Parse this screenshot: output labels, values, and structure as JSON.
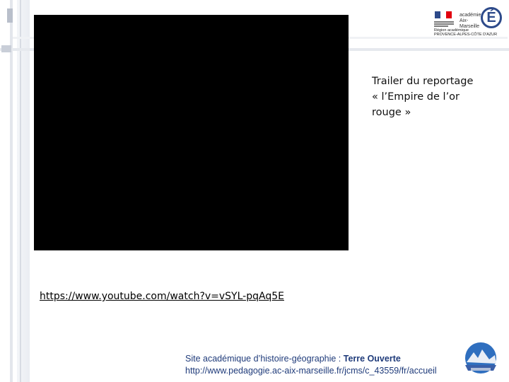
{
  "slide": {
    "caption_line1": "Trailer du reportage",
    "caption_line2": "« l’Empire de l’or",
    "caption_line3": "rouge »",
    "video_link": "https://www.youtube.com/watch?v=vSYL-pqAq5E"
  },
  "logo": {
    "academie_line1": "académie",
    "academie_line2": "Aix-Marseille",
    "region_line1": "Région académique",
    "region_line2": "PROVENCE-ALPES-CÔTE D'AZUR",
    "letter": "É",
    "colors": {
      "blue": "#2d4a8a",
      "red": "#e1000f"
    }
  },
  "footer": {
    "site_prefix": "Site académique d’histoire-géographie : ",
    "site_name": "Terre Ouverte",
    "url": "http://www.pedagogie.ac-aix-marseille.fr/jcms/c_43559/fr/accueil"
  }
}
